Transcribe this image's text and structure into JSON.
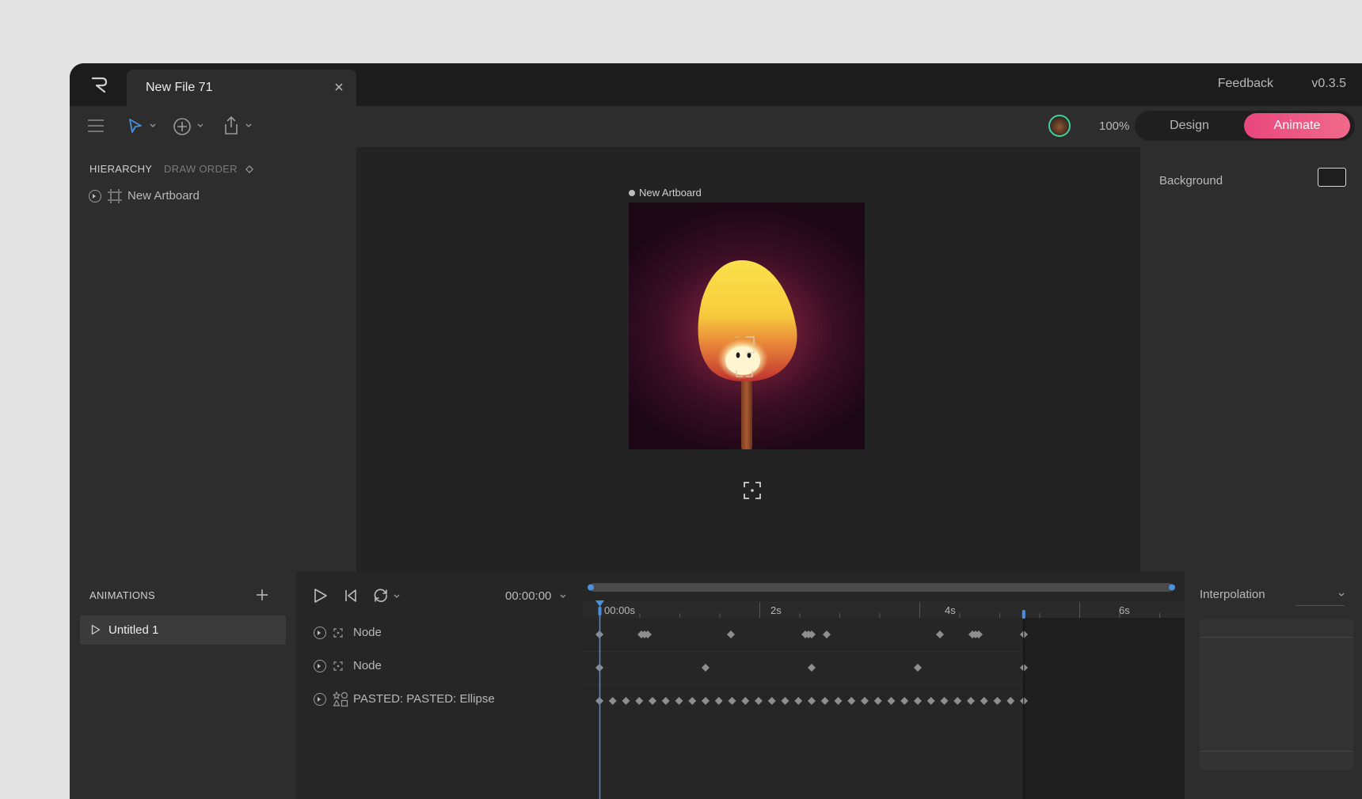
{
  "app": {
    "tab_title": "New File 71",
    "feedback": "Feedback",
    "version": "v0.3.5",
    "zoom": "100%",
    "modes": [
      "Design",
      "Animate"
    ],
    "active_mode": "Animate",
    "accent_color": "#ea4a80",
    "playhead_color": "#4a90e2"
  },
  "hierarchy": {
    "tab_hierarchy": "HIERARCHY",
    "tab_draw_order": "DRAW ORDER",
    "items": [
      {
        "label": "New Artboard"
      }
    ]
  },
  "stage": {
    "artboard_label": "New Artboard"
  },
  "inspector": {
    "background_label": "Background"
  },
  "animations": {
    "title": "ANIMATIONS",
    "items": [
      {
        "label": "Untitled 1"
      }
    ]
  },
  "timeline": {
    "time": "00:00:00",
    "ruler": [
      "00:00s",
      "2s",
      "4s",
      "6s"
    ],
    "layers": [
      {
        "label": "Node",
        "icon": "node-icon"
      },
      {
        "label": "Node",
        "icon": "node-icon"
      },
      {
        "label": "PASTED: PASTED: Ellipse",
        "icon": "shapes-icon"
      }
    ],
    "work_area_end_seconds": 5.3
  },
  "interpolation": {
    "title": "Interpolation"
  }
}
